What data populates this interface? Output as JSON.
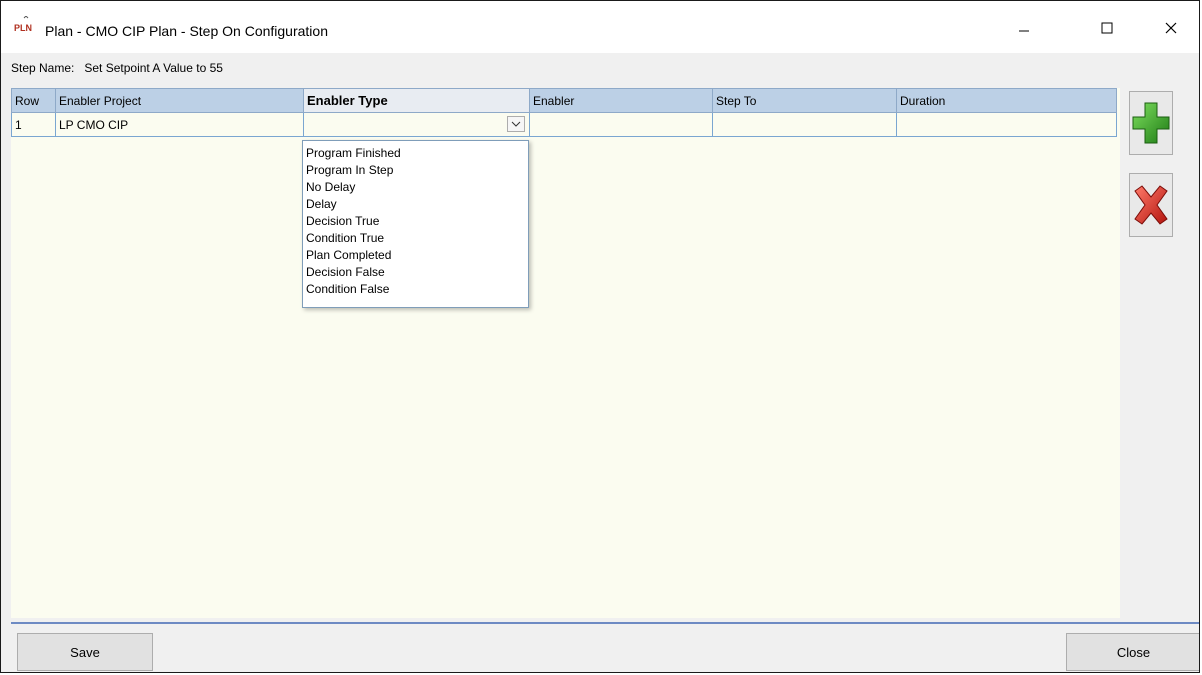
{
  "window": {
    "icon_text": "PLN",
    "title": "Plan - CMO CIP Plan - Step On Configuration",
    "minimize_symbol": "—",
    "maximize_symbol": "☐",
    "close_symbol": "✕"
  },
  "step": {
    "label": "Step Name:",
    "value": "Set Setpoint A Value to 55"
  },
  "grid": {
    "columns": [
      "Row",
      "Enabler Project",
      "Enabler Type",
      "Enabler",
      "Step To",
      "Duration"
    ],
    "rows": [
      {
        "row": "1",
        "enabler_project": "LP CMO CIP",
        "enabler_type": "",
        "enabler": "",
        "step_to": "",
        "duration": ""
      }
    ]
  },
  "dropdown": {
    "options": [
      "Program Finished",
      "Program In Step",
      "No Delay",
      "Delay",
      "Decision True",
      "Condition True",
      "Plan Completed",
      "Decision False",
      "Condition False"
    ]
  },
  "side_buttons": {
    "add_icon": "plus-icon",
    "delete_icon": "red-x-icon",
    "add_color": "#2e9e1f",
    "delete_color": "#d21f1f"
  },
  "footer": {
    "save_label": "Save",
    "close_label": "Close"
  }
}
